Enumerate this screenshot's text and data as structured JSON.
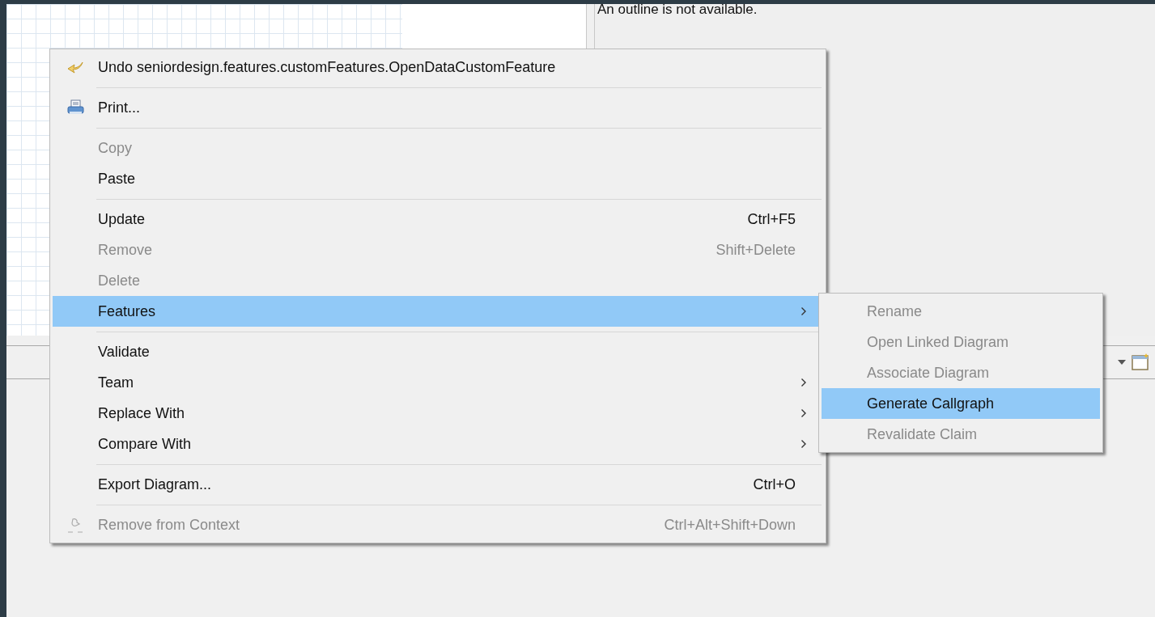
{
  "outline_panel": {
    "message": "An outline is not available."
  },
  "context_menu": {
    "items": [
      {
        "kind": "command",
        "label": "Undo seniordesign.features.customFeatures.OpenDataCustomFeature",
        "disabled": false,
        "selected": false
      },
      {
        "kind": "separator"
      },
      {
        "kind": "command",
        "label": "Print...",
        "disabled": false,
        "selected": false
      },
      {
        "kind": "separator"
      },
      {
        "kind": "command",
        "label": "Copy",
        "disabled": true,
        "selected": false
      },
      {
        "kind": "command",
        "label": "Paste",
        "disabled": false,
        "selected": false
      },
      {
        "kind": "separator"
      },
      {
        "kind": "command",
        "label": "Update",
        "shortcut": "Ctrl+F5",
        "disabled": false,
        "selected": false
      },
      {
        "kind": "command",
        "label": "Remove",
        "shortcut": "Shift+Delete",
        "disabled": true,
        "selected": false
      },
      {
        "kind": "command",
        "label": "Delete",
        "disabled": true,
        "selected": false
      },
      {
        "kind": "submenu",
        "label": "Features",
        "disabled": false,
        "selected": true
      },
      {
        "kind": "separator"
      },
      {
        "kind": "command",
        "label": "Validate",
        "disabled": false,
        "selected": false
      },
      {
        "kind": "submenu",
        "label": "Team",
        "disabled": false,
        "selected": false
      },
      {
        "kind": "submenu",
        "label": "Replace With",
        "disabled": false,
        "selected": false
      },
      {
        "kind": "submenu",
        "label": "Compare With",
        "disabled": false,
        "selected": false
      },
      {
        "kind": "separator"
      },
      {
        "kind": "command",
        "label": "Export Diagram...",
        "shortcut": "Ctrl+O",
        "disabled": false,
        "selected": false
      },
      {
        "kind": "separator"
      },
      {
        "kind": "command",
        "label": "Remove from Context",
        "shortcut": "Ctrl+Alt+Shift+Down",
        "disabled": true,
        "selected": false
      }
    ]
  },
  "submenu": {
    "items": [
      {
        "label": "Rename",
        "disabled": true,
        "selected": false
      },
      {
        "label": "Open Linked Diagram",
        "disabled": true,
        "selected": false
      },
      {
        "label": "Associate Diagram",
        "disabled": true,
        "selected": false
      },
      {
        "label": "Generate Callgraph",
        "disabled": false,
        "selected": true
      },
      {
        "label": "Revalidate Claim",
        "disabled": true,
        "selected": false
      }
    ]
  }
}
